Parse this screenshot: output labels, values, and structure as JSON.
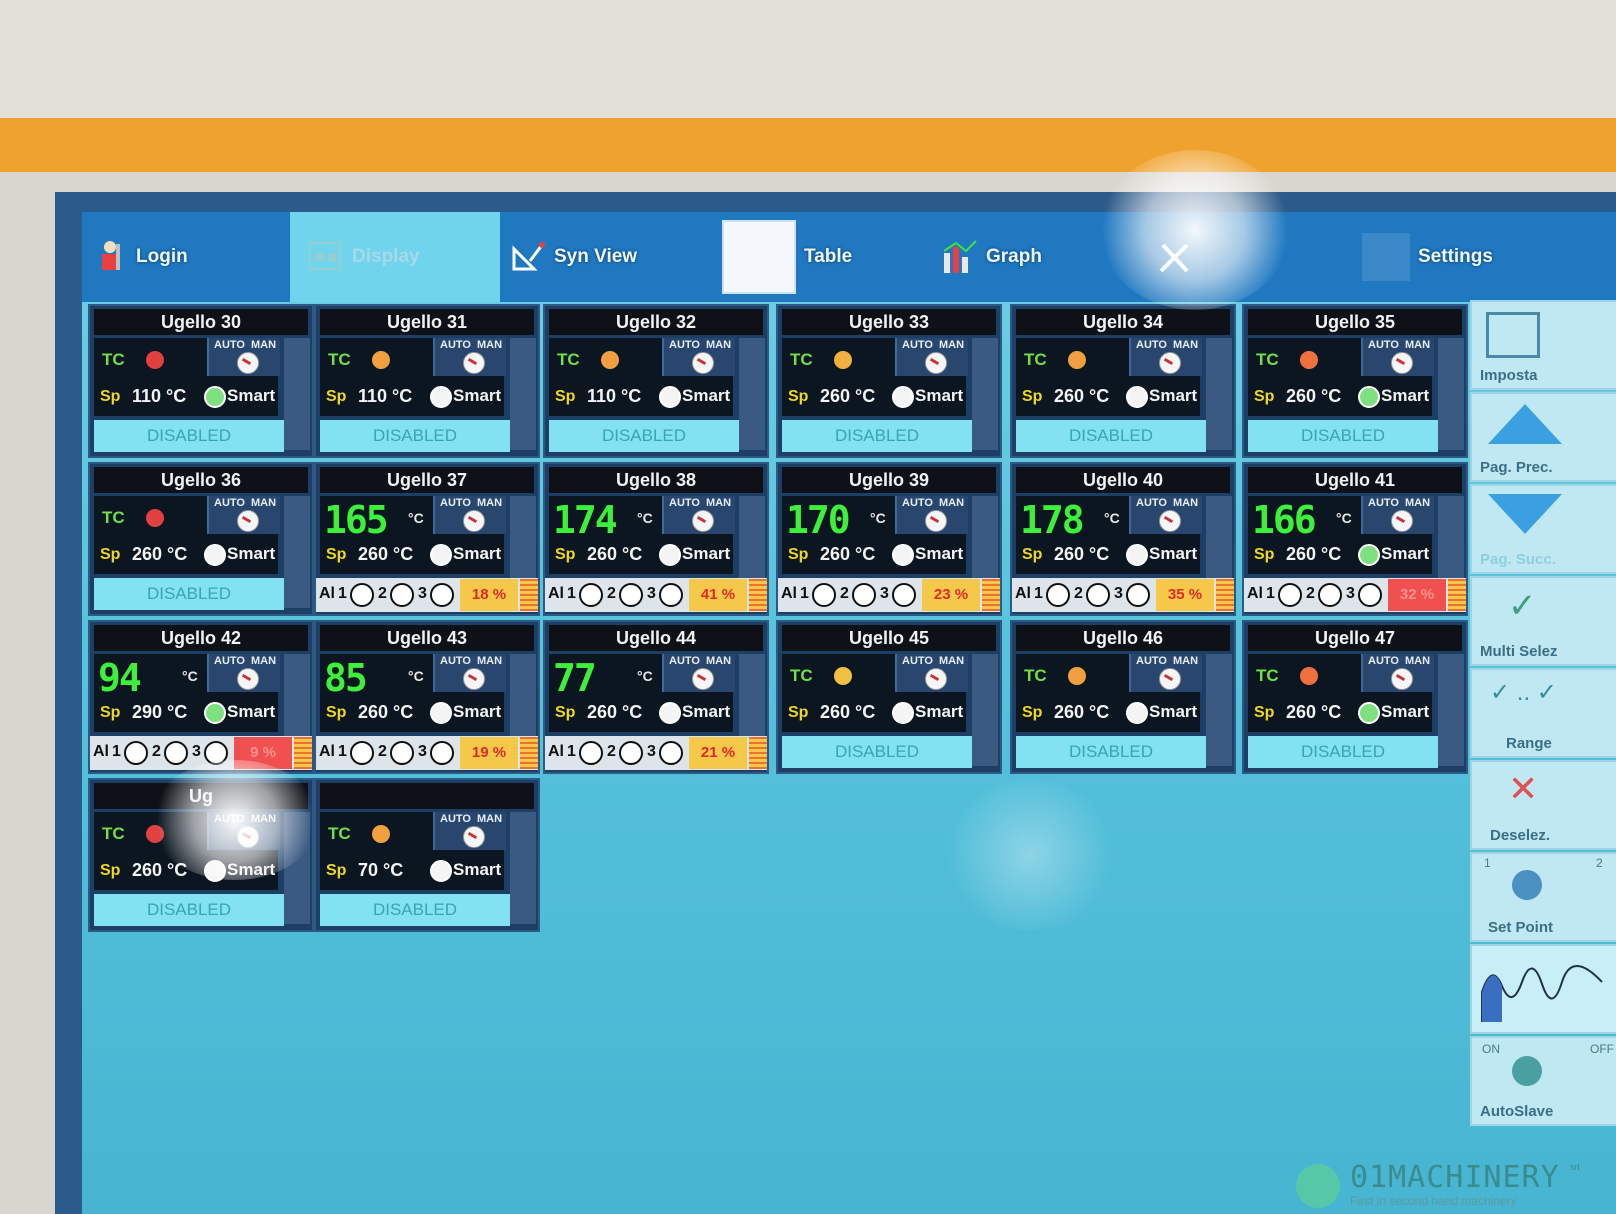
{
  "toolbar": {
    "login": "Login",
    "display": "Display",
    "syn_view": "Syn View",
    "table": "Table",
    "graph": "Graph",
    "settings": "Settings"
  },
  "labels": {
    "tc": "TC",
    "sp": "Sp",
    "auto": "AUTO",
    "man": "MAN",
    "smart": "Smart",
    "al": "Al",
    "disabled": "DISABLED",
    "unit": "°C"
  },
  "tiles": [
    {
      "title": "Ugello 30",
      "sp": "110 °C",
      "smart": "on",
      "tc_color": "#e04040"
    },
    {
      "title": "Ugello 31",
      "sp": "110 °C",
      "smart": "off",
      "tc_color": "#f0a040"
    },
    {
      "title": "Ugello 32",
      "sp": "110 °C",
      "smart": "off",
      "tc_color": "#f0a040"
    },
    {
      "title": "Ugello 33",
      "sp": "260 °C",
      "smart": "off",
      "tc_color": "#f0b040"
    },
    {
      "title": "Ugello 34",
      "sp": "260 °C",
      "smart": "off",
      "tc_color": "#f0a040"
    },
    {
      "title": "Ugello 35",
      "sp": "260 °C",
      "smart": "on",
      "tc_color": "#f07040"
    },
    {
      "title": "Ugello 36",
      "sp": "260 °C",
      "smart": "off",
      "tc_color": "#e04040"
    },
    {
      "title": "Ugello 37",
      "temp": "165",
      "sp": "260 °C",
      "smart": "off",
      "pct": "18 %"
    },
    {
      "title": "Ugello 38",
      "temp": "174",
      "sp": "260 °C",
      "smart": "off",
      "pct": "41 %"
    },
    {
      "title": "Ugello 39",
      "temp": "170",
      "sp": "260 °C",
      "smart": "off",
      "pct": "23 %"
    },
    {
      "title": "Ugello 40",
      "temp": "178",
      "sp": "260 °C",
      "smart": "off",
      "pct": "35 %"
    },
    {
      "title": "Ugello 41",
      "temp": "166",
      "sp": "260 °C",
      "smart": "on",
      "pct": "32 %"
    },
    {
      "title": "Ugello 42",
      "temp": "94",
      "sp": "290 °C",
      "smart": "on",
      "pct": "9 %"
    },
    {
      "title": "Ugello 43",
      "temp": "85",
      "sp": "260 °C",
      "smart": "off",
      "pct": "19 %"
    },
    {
      "title": "Ugello 44",
      "temp": "77",
      "sp": "260 °C",
      "smart": "off",
      "pct": "21 %"
    },
    {
      "title": "Ugello 45",
      "sp": "260 °C",
      "smart": "off",
      "tc_color": "#f0c040"
    },
    {
      "title": "Ugello 46",
      "sp": "260 °C",
      "smart": "off",
      "tc_color": "#f0a040"
    },
    {
      "title": "Ugello 47",
      "sp": "260 °C",
      "smart": "on",
      "tc_color": "#f07040"
    },
    {
      "title": "Ug",
      "sp": "260 °C",
      "smart": "off",
      "tc_color": "#e04040"
    },
    {
      "title": "",
      "sp": "70 °C",
      "smart": "off",
      "tc_color": "#f0a040"
    }
  ],
  "sidebar": {
    "imposta": "Imposta",
    "pag_prec": "Pag. Prec.",
    "pag_succ": "Pag. Succ.",
    "multi_selez": "Multi Selez",
    "range": "Range",
    "deselez": "Deselez.",
    "set_point": "Set Point",
    "autoslave": "AutoSlave",
    "on": "ON",
    "off": "OFF",
    "one": "1",
    "two": "2"
  },
  "watermark": {
    "brand": "01MACHINERY",
    "srl": "srl",
    "tagline": "First in second hand machinery"
  },
  "colors": {
    "accent_toolbar": "#1f78c0",
    "screen_bg": "#56c2dc",
    "temp_digits": "#3cf03c",
    "alarm_pct": "#e02a2a"
  }
}
